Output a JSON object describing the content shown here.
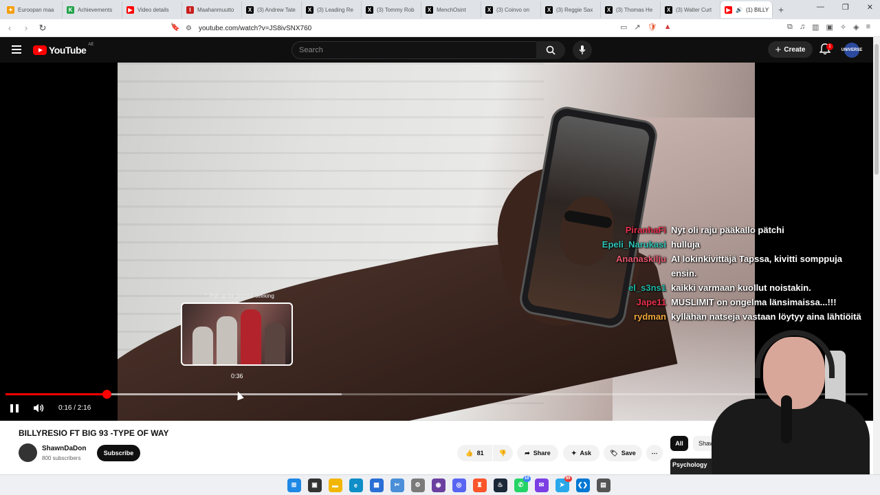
{
  "browser": {
    "tabs": [
      {
        "title": "Euroopan maa",
        "icon": "orange-star-icon",
        "color": "#f59e0b",
        "glyph": "✦"
      },
      {
        "title": "Achievements",
        "icon": "k-icon",
        "color": "#22a34a",
        "glyph": "K"
      },
      {
        "title": "Video details",
        "icon": "youtube-studio-icon",
        "color": "#ff0000",
        "glyph": "▶"
      },
      {
        "title": "Maahanmuutto",
        "icon": "il-icon",
        "color": "#c81e1e",
        "glyph": "I"
      },
      {
        "title": "(3) Andrew Tate",
        "icon": "x-icon",
        "color": "#000000",
        "glyph": "X"
      },
      {
        "title": "(3) Leading Re",
        "icon": "x-icon",
        "color": "#000000",
        "glyph": "X"
      },
      {
        "title": "(3) Tommy Rob",
        "icon": "x-icon",
        "color": "#000000",
        "glyph": "X"
      },
      {
        "title": "MenchOsint",
        "icon": "x-icon",
        "color": "#000000",
        "glyph": "X"
      },
      {
        "title": "(3) Coinvo on",
        "icon": "x-icon",
        "color": "#000000",
        "glyph": "X"
      },
      {
        "title": "(3) Reggie Sax",
        "icon": "x-icon",
        "color": "#000000",
        "glyph": "X"
      },
      {
        "title": "(3) Thomas He",
        "icon": "x-icon",
        "color": "#000000",
        "glyph": "X"
      },
      {
        "title": "(3) Walter Curt",
        "icon": "x-icon",
        "color": "#000000",
        "glyph": "X"
      }
    ],
    "active_tab": {
      "title": "(1) BILLY",
      "icon": "youtube-icon",
      "color": "#ff0000",
      "glyph": "▶",
      "sound_icon": "speaker-icon"
    },
    "url": "youtube.com/watch?v=JS8ivSNX760"
  },
  "youtube": {
    "logo_text": "YouTube",
    "country_code": "AE",
    "search_placeholder": "Search",
    "create_label": "Create",
    "notification_count": "1",
    "avatar_text": "UNIVERSE"
  },
  "player": {
    "current_time": "0:16",
    "duration": "2:16",
    "time_display": "0:16 / 2:16",
    "progress_fraction": 0.1176,
    "hover_time": "0:36",
    "seek_hint": "Pull up for precise seeking"
  },
  "chat": [
    {
      "user": "PiranhaFi",
      "color": "#e8304d",
      "message": "Nyt oli raju pääkallo pätchi"
    },
    {
      "user": "Epeli_Narukasi",
      "color": "#2ec4b6",
      "message": "hulluja"
    },
    {
      "user": "Ananaskilju",
      "color": "#e8566e",
      "message": "AI lokinkivittäjä Tapssa, kivitti somppuja ensin."
    },
    {
      "user": "el_s3ns1",
      "color": "#1fb8a5",
      "message": "kaikki varmaan kuollut noistakin."
    },
    {
      "user": "Jape11",
      "color": "#e8304d",
      "message": "MUSLIMIT on ongelma länsimaissa...!!!"
    },
    {
      "user": "rydman",
      "color": "#f2a93b",
      "message": "kyllähän natseja vastaan löytyy aina lähtiöitä"
    }
  ],
  "video": {
    "title": "BILLYRESIO FT BIG 93 -TYPE OF WAY",
    "channel": "ShawnDaDon",
    "subscribers": "800 subscribers",
    "subscribe_label": "Subscribe",
    "likes": "81",
    "share_label": "Share",
    "ask_label": "Ask",
    "save_label": "Save"
  },
  "sidebar": {
    "chip_all": "All",
    "chip_2": "ShawnDa",
    "thumb_text": "Psychology"
  },
  "taskbar": {
    "badges": {
      "whatsapp": "10",
      "telegram": "89"
    }
  }
}
